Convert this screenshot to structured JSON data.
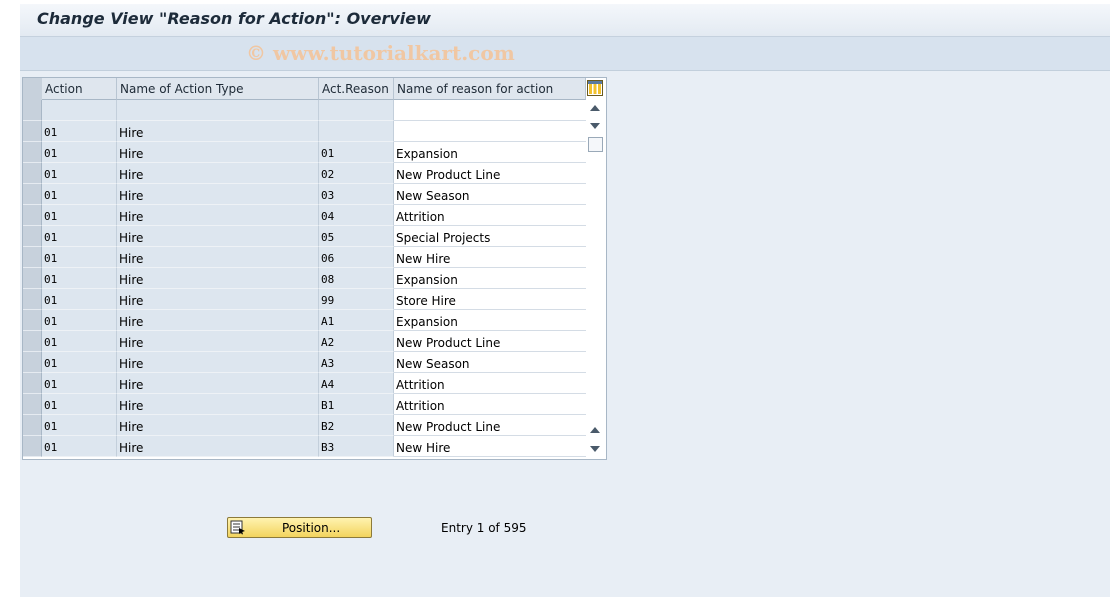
{
  "window": {
    "title": "Change View \"Reason for Action\": Overview"
  },
  "watermark": "© www.tutorialkart.com",
  "table": {
    "columns": [
      "Action",
      "Name of Action Type",
      "Act.Reason",
      "Name of reason for action"
    ],
    "rows": [
      [
        "",
        "",
        "",
        ""
      ],
      [
        "01",
        "Hire",
        "",
        ""
      ],
      [
        "01",
        "Hire",
        "01",
        "Expansion"
      ],
      [
        "01",
        "Hire",
        "02",
        "New Product Line"
      ],
      [
        "01",
        "Hire",
        "03",
        "New Season"
      ],
      [
        "01",
        "Hire",
        "04",
        "Attrition"
      ],
      [
        "01",
        "Hire",
        "05",
        "Special Projects"
      ],
      [
        "01",
        "Hire",
        "06",
        "New Hire"
      ],
      [
        "01",
        "Hire",
        "08",
        "Expansion"
      ],
      [
        "01",
        "Hire",
        "99",
        "Store Hire"
      ],
      [
        "01",
        "Hire",
        "A1",
        "Expansion"
      ],
      [
        "01",
        "Hire",
        "A2",
        "New Product Line"
      ],
      [
        "01",
        "Hire",
        "A3",
        "New Season"
      ],
      [
        "01",
        "Hire",
        "A4",
        "Attrition"
      ],
      [
        "01",
        "Hire",
        "B1",
        "Attrition"
      ],
      [
        "01",
        "Hire",
        "B2",
        "New Product Line"
      ],
      [
        "01",
        "Hire",
        "B3",
        "New Hire"
      ]
    ]
  },
  "footer": {
    "position_button": "Position...",
    "entry_text": "Entry 1 of 595"
  },
  "icons": {
    "config": "table-settings-icon",
    "position": "position-icon",
    "scroll_up": "scroll-up-icon",
    "scroll_down": "scroll-down-icon"
  }
}
